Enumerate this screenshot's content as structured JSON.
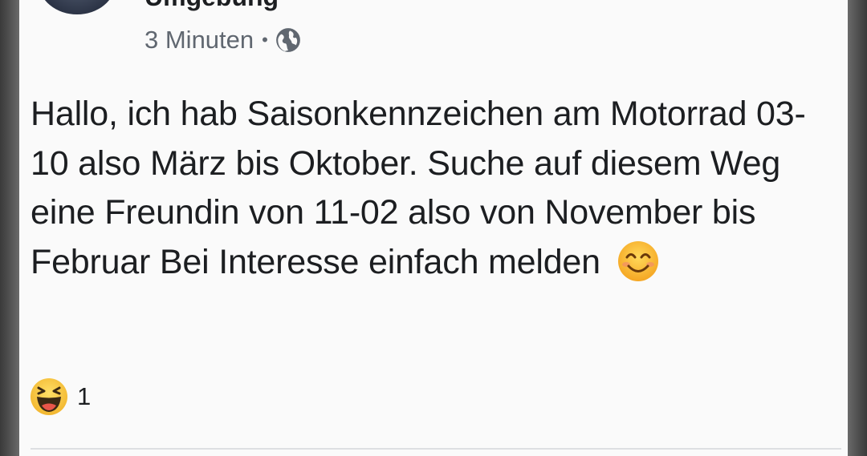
{
  "post": {
    "author": "Umgebung",
    "timestamp": "3 Minuten",
    "separator": "•",
    "privacy_icon": "globe-icon",
    "text": "Hallo, ich hab Saisonkennzeichen am Motorrad 03-10 also März bis Oktober. Suche auf diesem Weg eine Freundin von 11-02 also von November bis Februar Bei Interesse einfach melden",
    "text_emoji": "smiling-face-icon"
  },
  "reactions": {
    "icon": "haha-icon",
    "count": "1"
  },
  "colors": {
    "text": "#1c1e21",
    "meta": "#606770",
    "emoji": "#f7c034"
  }
}
